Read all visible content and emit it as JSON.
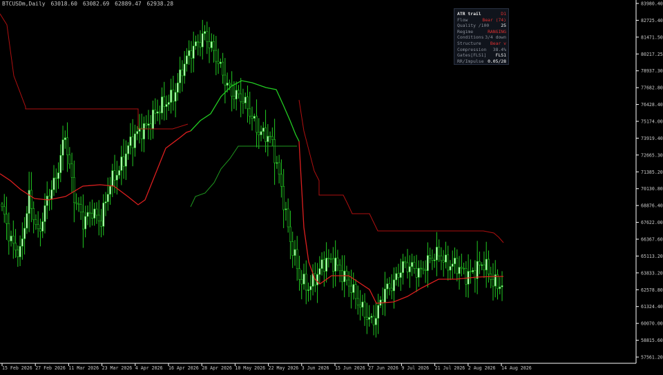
{
  "header": {
    "symbol": "BTCUSDm,Daily",
    "open": "63018.60",
    "high": "63082.69",
    "low": "62889.47",
    "close": "62938.28"
  },
  "panel": {
    "title": "ATR trail",
    "title_value": "D1",
    "title_color": "#e03030",
    "rows": [
      {
        "label": "Flow",
        "value": "Bear (74)",
        "color": "#e03030"
      },
      {
        "label": "Quality /100",
        "value": "25",
        "color": "#ffffff"
      },
      {
        "label": "Regime",
        "value": "RANGING",
        "color": "#e03030"
      },
      {
        "label": "Conditions",
        "value": "3/4 down",
        "color": "#8a8f99"
      },
      {
        "label": "Structure",
        "value": "Bear v",
        "color": "#e03030"
      },
      {
        "label": "Compression",
        "value": "38.4%",
        "color": "#8a8f99"
      },
      {
        "label": "Gates[FLS1]",
        "value": "FLS1",
        "color": "#ffffff"
      },
      {
        "label": "RR/Impulse",
        "value": "0.05/28",
        "color": "#ffffff"
      }
    ]
  },
  "price_axis": [
    "83980.40",
    "82725.40",
    "81471.50",
    "80217.25",
    "78937.30",
    "77682.80",
    "76428.40",
    "75174.00",
    "73919.40",
    "72665.30",
    "71385.20",
    "70130.80",
    "68876.40",
    "67622.00",
    "66367.60",
    "65113.20",
    "63833.20",
    "62578.80",
    "61324.40",
    "60070.00",
    "58815.60",
    "57561.20"
  ],
  "time_axis": [
    "15 Feb 2026",
    "27 Feb 2026",
    "11 Mar 2026",
    "23 Mar 2026",
    "4 Apr 2026",
    "16 Apr 2026",
    "28 Apr 2026",
    "10 May 2026",
    "22 May 2026",
    "3 Jun 2026",
    "15 Jun 2026",
    "27 Jun 2026",
    "9 Jul 2026",
    "21 Jul 2026",
    "2 Aug 2026",
    "14 Aug 2026"
  ],
  "colors": {
    "background": "#000000",
    "bull_candle": "#c8ffc8",
    "bear_candle": "#000000",
    "wick": "#22cc22",
    "trail_red": "#dd1f1f",
    "trail_green": "#22cc22",
    "upper_trail": "#b01010",
    "lower_trail": "#1f9a1f",
    "axis": "#ffffff",
    "axis_text": "#c8c8c8"
  }
}
